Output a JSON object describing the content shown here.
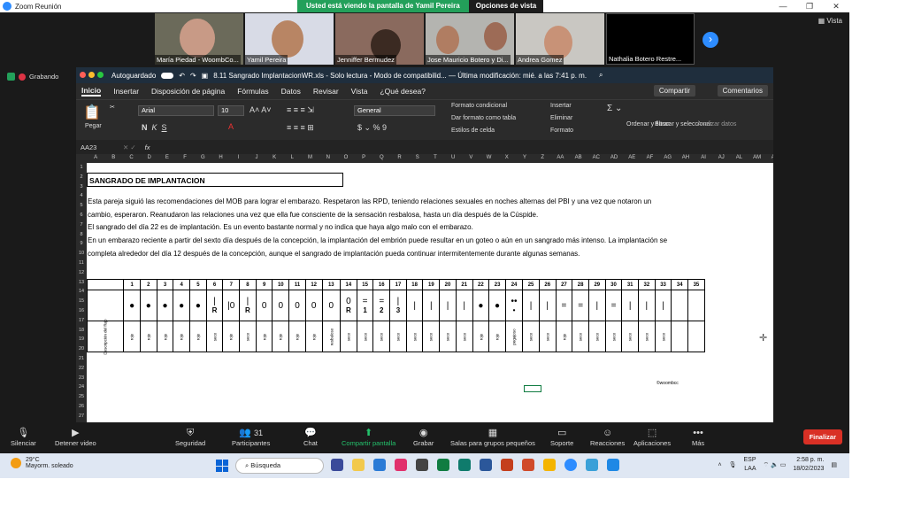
{
  "zoom": {
    "title": "Zoom Reunión",
    "banner": "Usted está viendo la pantalla de Yamil Pereira",
    "view_options": "Opciones de vista",
    "vista": "Vista",
    "recording": "Grabando",
    "participants": [
      "María Piedad - WoombCo...",
      "Yamil Pereira",
      "Jenniffer Bermudez",
      "Jose Mauricio Botero y Di...",
      "Andrea Gomez",
      "Nathalia Botero Restre..."
    ],
    "toolbar": {
      "mute": "Silenciar",
      "video": "Detener video",
      "security": "Seguridad",
      "participants": "Participantes",
      "participants_count": "31",
      "chat": "Chat",
      "share": "Compartir pantalla",
      "record": "Grabar",
      "rooms": "Salas para grupos pequeños",
      "support": "Soporte",
      "reactions": "Reacciones",
      "apps": "Aplicaciones",
      "more": "Más",
      "end": "Finalizar"
    }
  },
  "excel": {
    "autosave": "Autoguardado",
    "doc_title": "8.11 Sangrado ImplantacionWR.xls - Solo lectura - Modo de compatibilid... — Última modificación: mié. a las 7:41 p. m.",
    "tabs": [
      "Inicio",
      "Insertar",
      "Disposición de página",
      "Fórmulas",
      "Datos",
      "Revisar",
      "Vista",
      "¿Qué desea?"
    ],
    "share": "Compartir",
    "comments": "Comentarios",
    "ribbon": {
      "paste": "Pegar",
      "font": "Arial",
      "size": "10",
      "number_format": "General",
      "cond_format": "Formato condicional",
      "table_format": "Dar formato como tabla",
      "cell_styles": "Estilos de celda",
      "insert": "Insertar",
      "delete": "Eliminar",
      "format": "Formato",
      "sort": "Ordenar y filtrar",
      "find": "Buscar y seleccionar",
      "analyze": "Analizar datos"
    },
    "cell_ref": "AA23",
    "fx": "fx",
    "columns": [
      "A",
      "B",
      "C",
      "D",
      "E",
      "F",
      "G",
      "H",
      "I",
      "J",
      "K",
      "L",
      "M",
      "N",
      "O",
      "P",
      "Q",
      "R",
      "S",
      "T",
      "U",
      "V",
      "W",
      "X",
      "Y",
      "Z",
      "AA",
      "AB",
      "AC",
      "AD",
      "AE",
      "AF",
      "AG",
      "AH",
      "AI",
      "AJ",
      "AL",
      "AM",
      "AN"
    ],
    "rows": [
      "1",
      "2",
      "3",
      "4",
      "5",
      "6",
      "7",
      "8",
      "9",
      "10",
      "11",
      "12",
      "13",
      "14",
      "15",
      "16",
      "17",
      "18",
      "19",
      "20",
      "21",
      "22",
      "23",
      "24",
      "25",
      "26",
      "27"
    ],
    "sheet_title": "SANGRADO DE IMPLANTACION",
    "paragraphs": [
      "Esta pareja siguió las recomendaciones del MOB para lograr el embarazo. Respetaron las RPD, teniendo relaciones sexuales en noches alternas del PBI y una vez que notaron un",
      "cambio, esperaron. Reanudaron las relaciones una vez que ella fue consciente de la sensación resbalosa, hasta un día después de la Cúspide.",
      "El sangrado del día 22 es de implantación. Es un evento bastante normal y no indica que haya algo malo con el embarazo.",
      "En un embarazo reciente a partir del sexto día después de la concepción, la implantación del embrión puede resultar en un goteo o aún en un sangrado más intenso. La implantación se",
      "completa alrededor del día 12 después de la concepción, aunque el sangrado de implantación pueda continuar intermitentemente durante algunas semanas."
    ],
    "days": [
      "1",
      "2",
      "3",
      "4",
      "5",
      "6",
      "7",
      "8",
      "9",
      "10",
      "11",
      "12",
      "13",
      "14",
      "15",
      "16",
      "17",
      "18",
      "19",
      "20",
      "21",
      "22",
      "23",
      "24",
      "25",
      "26",
      "27",
      "28",
      "29",
      "30",
      "31",
      "32",
      "33",
      "34",
      "35"
    ],
    "symbols": [
      "●",
      "●",
      "●",
      "●",
      "●",
      "|",
      "|0",
      "|",
      "0",
      "0",
      "0",
      "0",
      "0",
      "0",
      "=",
      "=",
      "|",
      "|",
      "|",
      "|",
      "|",
      "●",
      "●",
      "••",
      "|",
      "|",
      "=",
      "=",
      "|",
      "=",
      "|",
      "|",
      "|",
      "",
      ""
    ],
    "sub": [
      "",
      "",
      "",
      "",
      "",
      "R",
      "",
      "R",
      "",
      "",
      "",
      "",
      "",
      "R",
      "1",
      "2",
      "3",
      "",
      "",
      "",
      "",
      "",
      "",
      "•",
      "",
      "",
      "",
      "",
      "",
      "",
      "",
      "",
      "",
      "",
      ""
    ],
    "labels": [
      "rojo",
      "rojo",
      "rojo",
      "rojo",
      "rojo",
      "seco",
      "rojo",
      "seco",
      "rojo",
      "rojo",
      "rojo",
      "rojo",
      "resbaloso",
      "seco",
      "seco",
      "seco",
      "seco",
      "seco",
      "seco",
      "seco",
      "seco",
      "rojo",
      "rojo",
      "pegajoso",
      "seco",
      "seco",
      "rojo",
      "seco",
      "seco",
      "seco",
      "seco",
      "seco",
      "seco",
      "",
      ""
    ],
    "row_label": "Descripción del flujo",
    "copyright": "©woombcc"
  },
  "taskbar": {
    "temp": "29°C",
    "weather": "Mayorm. soleado",
    "search": "Búsqueda",
    "lang1": "ESP",
    "lang2": "LAA",
    "time": "2:58 p. m.",
    "date": "18/02/2023"
  }
}
